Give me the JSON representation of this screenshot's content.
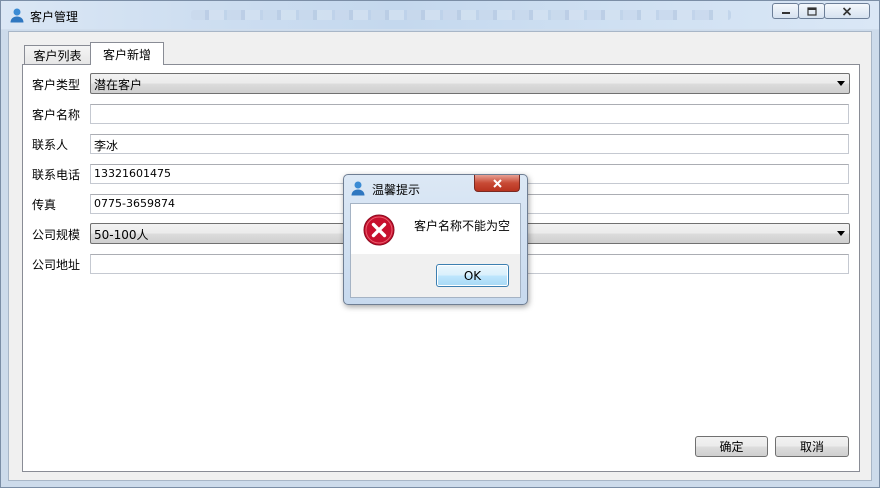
{
  "window": {
    "title": "客户管理",
    "app_icon": "user-icon"
  },
  "window_controls": {
    "minimize": "minimize-icon",
    "maximize": "maximize-icon",
    "close": "close-icon"
  },
  "tabs": [
    {
      "label": "客户列表",
      "active": false
    },
    {
      "label": "客户新增",
      "active": true
    }
  ],
  "form": {
    "customer_type": {
      "label": "客户类型",
      "value": "潜在客户"
    },
    "customer_name": {
      "label": "客户名称",
      "value": ""
    },
    "contact": {
      "label": "联系人",
      "value": "李冰"
    },
    "phone": {
      "label": "联系电话",
      "value": "13321601475"
    },
    "fax": {
      "label": "传真",
      "value": "0775-3659874"
    },
    "company_size": {
      "label": "公司规模",
      "value": "50-100人"
    },
    "address": {
      "label": "公司地址",
      "value": ""
    }
  },
  "buttons": {
    "confirm": "确定",
    "cancel": "取消"
  },
  "dialog": {
    "title": "温馨提示",
    "message": "客户名称不能为空",
    "ok": "OK",
    "icon": "error-icon",
    "close": "close-icon"
  },
  "colors": {
    "error_red": "#c8102e",
    "dialog_close": "#c84a35",
    "accent": "#3c7fb1"
  }
}
